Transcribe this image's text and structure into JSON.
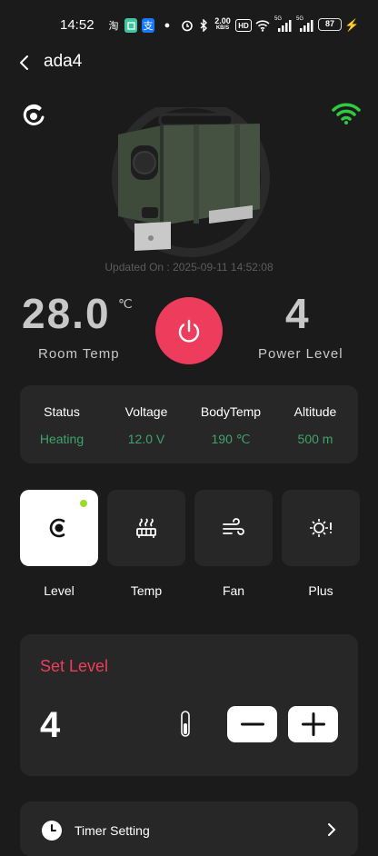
{
  "status_bar": {
    "time": "14:52",
    "app_icons": [
      "淘",
      "支"
    ],
    "net_speed_top": "2.00",
    "net_speed_unit": "KB/S",
    "hd_label": "HD",
    "signal_5g_1": "5G",
    "signal_5g_2": "5G",
    "battery": "87"
  },
  "header": {
    "title": "ada4"
  },
  "device": {
    "updated_text": "Updated On : 2025-09-11 14:52:08"
  },
  "metrics": {
    "room_temp_value": "28.0",
    "room_temp_unit": "℃",
    "room_temp_label": "Room Temp",
    "power_level_value": "4",
    "power_level_label": "Power Level"
  },
  "status_card": {
    "columns": [
      {
        "head": "Status",
        "value": "Heating"
      },
      {
        "head": "Voltage",
        "value": "12.0 V"
      },
      {
        "head": "BodyTemp",
        "value": "190 ℃"
      },
      {
        "head": "Altitude",
        "value": "500 m"
      }
    ],
    "value_color": "#3fa36a"
  },
  "modes": [
    {
      "label": "Level",
      "icon": "level-icon",
      "active": true
    },
    {
      "label": "Temp",
      "icon": "heater-icon",
      "active": false
    },
    {
      "label": "Fan",
      "icon": "wind-icon",
      "active": false
    },
    {
      "label": "Plus",
      "icon": "plus-mode-icon",
      "active": false
    }
  ],
  "set_level": {
    "title": "Set Level",
    "value": "4"
  },
  "timer": {
    "label": "Timer Setting"
  },
  "colors": {
    "accent": "#ee3d5c",
    "background": "#1b1b1b",
    "card": "#272727",
    "wifi": "#2ecc40"
  }
}
